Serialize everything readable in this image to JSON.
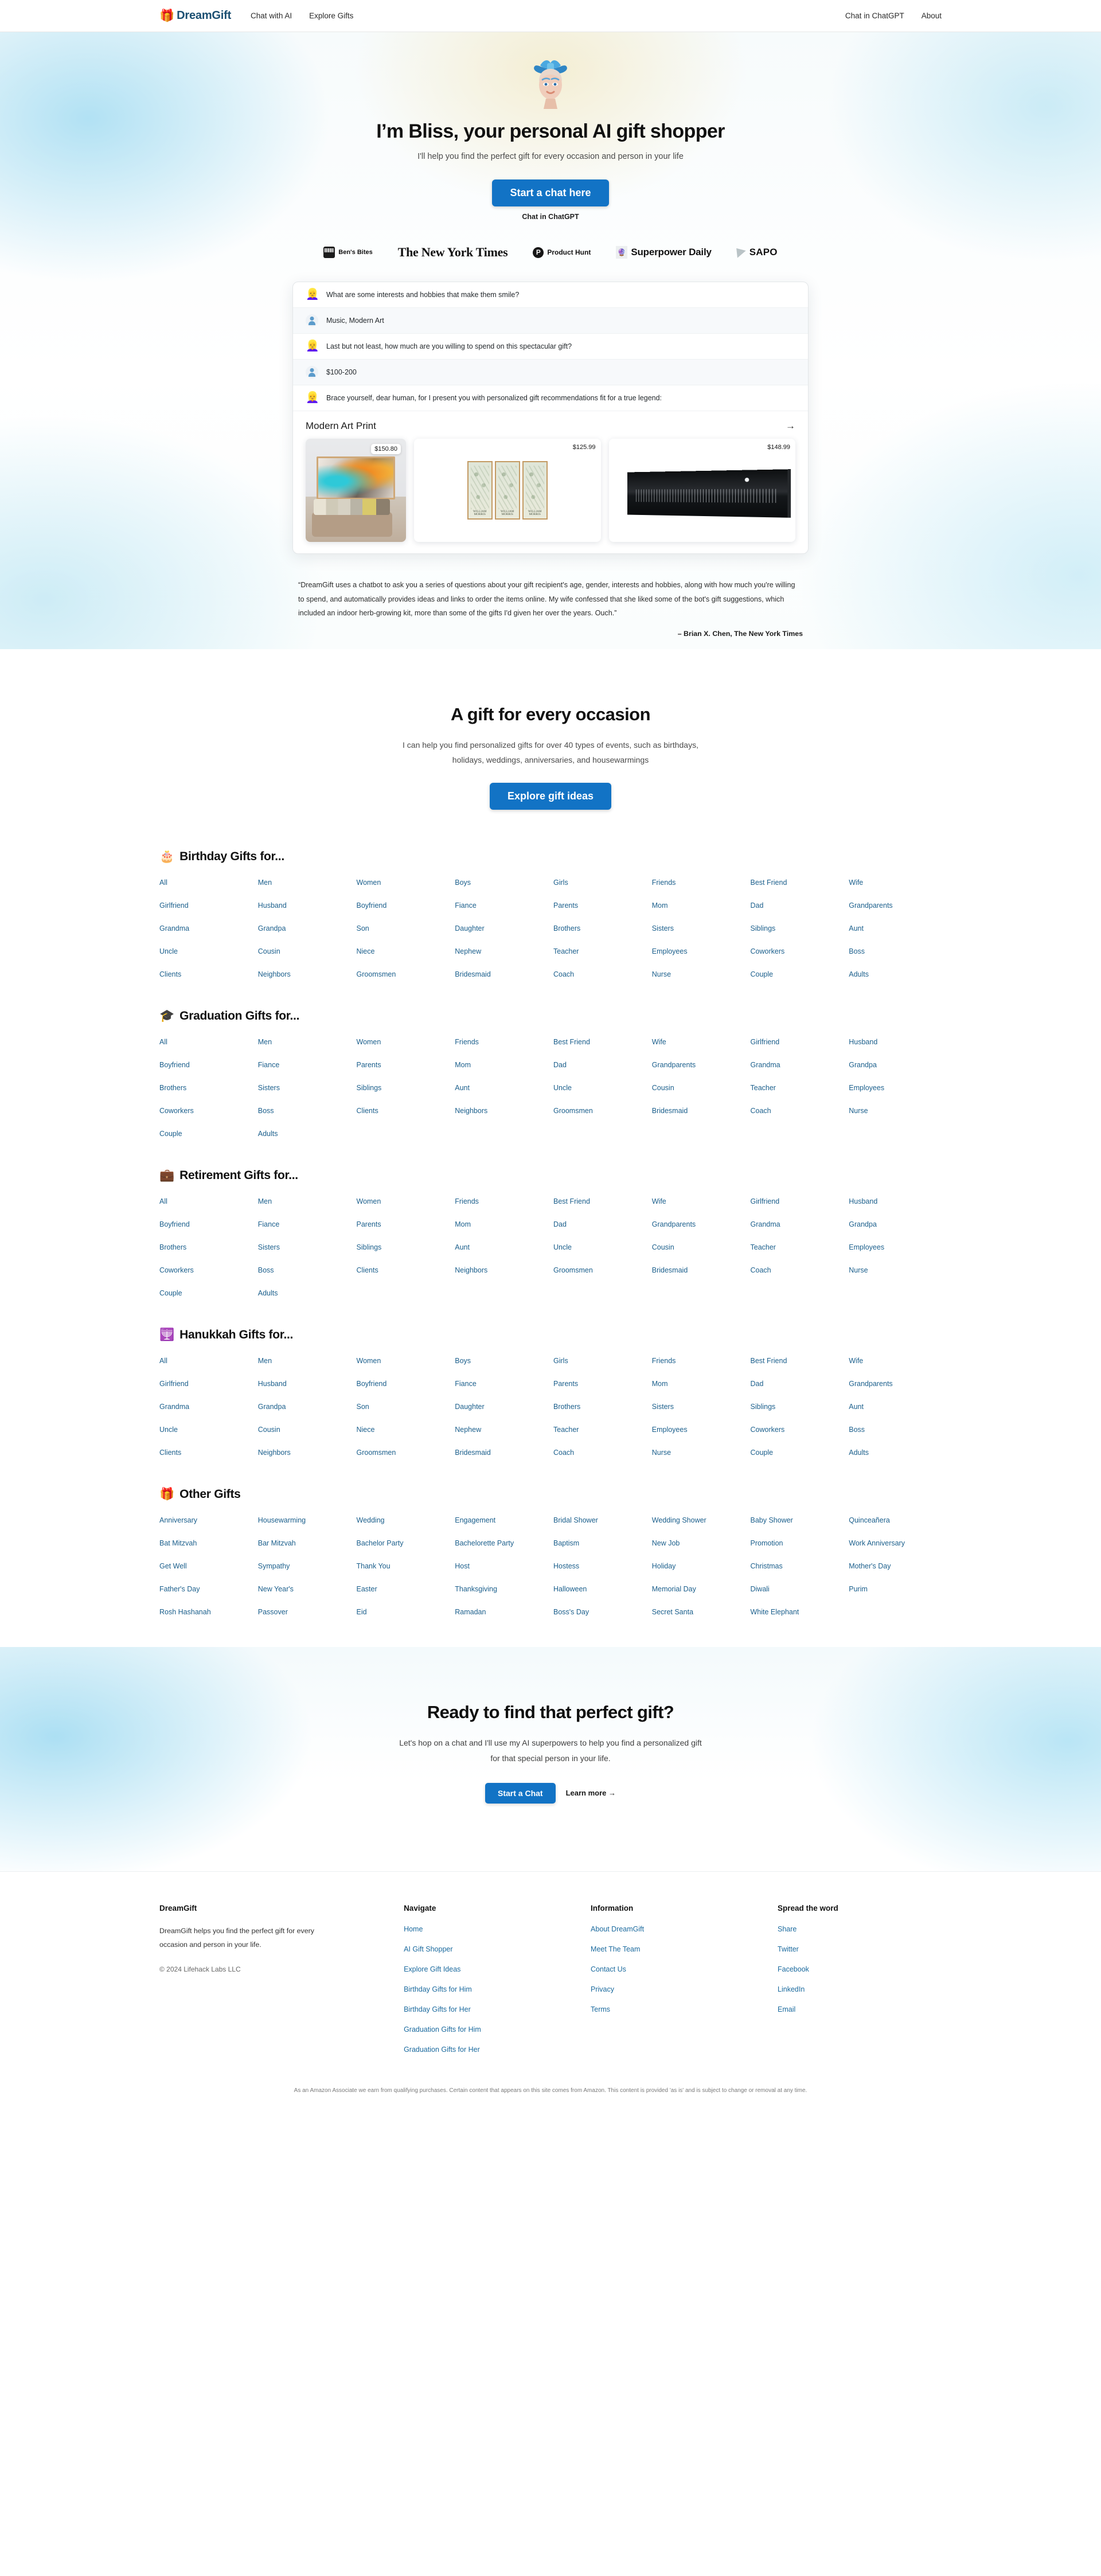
{
  "header": {
    "brand_emoji": "🎁",
    "brand_name": "DreamGift",
    "nav_left": [
      {
        "label": "Chat with AI"
      },
      {
        "label": "Explore Gifts"
      }
    ],
    "nav_right": [
      {
        "label": "Chat in ChatGPT"
      },
      {
        "label": "About"
      }
    ]
  },
  "hero": {
    "avatar_icon": "bliss-avatar",
    "title": "I’m Bliss, your personal AI gift shopper",
    "subtitle": "I'll help you find the perfect gift for every occasion and person in your life",
    "cta_label": "Start a chat here",
    "secondary_label": "Chat in ChatGPT"
  },
  "press": [
    {
      "name": "Ben's Bites",
      "icon": "bens-bites-icon"
    },
    {
      "name": "The New York Times",
      "icon": "nyt-wordmark"
    },
    {
      "name": "Product Hunt",
      "icon": "product-hunt-icon"
    },
    {
      "name": "Superpower Daily",
      "icon": "superpower-daily-icon"
    },
    {
      "name": "SAPO",
      "icon": "sapo-icon"
    }
  ],
  "chat_demo": {
    "messages": [
      {
        "role": "bot",
        "text": "What are some interests and hobbies that make them smile?"
      },
      {
        "role": "user",
        "text": "Music, Modern Art"
      },
      {
        "role": "bot",
        "text": "Last but not least, how much are you willing to spend on this spectacular gift?"
      },
      {
        "role": "user",
        "text": "$100-200"
      },
      {
        "role": "bot",
        "text": "Brace yourself, dear human, for I present you with personalized gift recommendations fit for a true legend:"
      }
    ],
    "recommendation": {
      "title": "Modern Art Print",
      "arrow_icon": "arrow-right-icon",
      "products": [
        {
          "price": "$150.80",
          "image": "abstract-canvas-over-sofa"
        },
        {
          "price": "$125.99",
          "image": "william-morris-triptych"
        },
        {
          "price": "$148.99",
          "image": "brooklyn-bridge-black-and-white"
        }
      ]
    }
  },
  "testimonial": {
    "quote": "“DreamGift uses a chatbot to ask you a series of questions about your gift recipient's age, gender, interests and hobbies, along with how much you're willing to spend, and automatically provides ideas and links to order the items online. My wife confessed that she liked some of the bot's gift suggestions, which included an indoor herb-growing kit, more than some of the gifts I'd given her over the years. Ouch.”",
    "attribution": "– Brian X. Chen, The New York Times"
  },
  "occasions_intro": {
    "title": "A gift for every occasion",
    "subtitle": "I can help you find personalized gifts for over 40 types of events, such as birthdays, holidays, weddings, anniversaries, and housewarmings",
    "cta_label": "Explore gift ideas"
  },
  "categories": [
    {
      "emoji": "🎂",
      "title": "Birthday Gifts for...",
      "links": [
        "All",
        "Men",
        "Women",
        "Boys",
        "Girls",
        "Friends",
        "Best Friend",
        "Wife",
        "Girlfriend",
        "Husband",
        "Boyfriend",
        "Fiance",
        "Parents",
        "Mom",
        "Dad",
        "Grandparents",
        "Grandma",
        "Grandpa",
        "Son",
        "Daughter",
        "Brothers",
        "Sisters",
        "Siblings",
        "Aunt",
        "Uncle",
        "Cousin",
        "Niece",
        "Nephew",
        "Teacher",
        "Employees",
        "Coworkers",
        "Boss",
        "Clients",
        "Neighbors",
        "Groomsmen",
        "Bridesmaid",
        "Coach",
        "Nurse",
        "Couple",
        "Adults"
      ]
    },
    {
      "emoji": "🎓",
      "title": "Graduation Gifts for...",
      "links": [
        "All",
        "Men",
        "Women",
        "Friends",
        "Best Friend",
        "Wife",
        "Girlfriend",
        "Husband",
        "Boyfriend",
        "Fiance",
        "Parents",
        "Mom",
        "Dad",
        "Grandparents",
        "Grandma",
        "Grandpa",
        "Brothers",
        "Sisters",
        "Siblings",
        "Aunt",
        "Uncle",
        "Cousin",
        "Teacher",
        "Employees",
        "Coworkers",
        "Boss",
        "Clients",
        "Neighbors",
        "Groomsmen",
        "Bridesmaid",
        "Coach",
        "Nurse",
        "Couple",
        "Adults"
      ]
    },
    {
      "emoji": "💼",
      "title": "Retirement Gifts for...",
      "links": [
        "All",
        "Men",
        "Women",
        "Friends",
        "Best Friend",
        "Wife",
        "Girlfriend",
        "Husband",
        "Boyfriend",
        "Fiance",
        "Parents",
        "Mom",
        "Dad",
        "Grandparents",
        "Grandma",
        "Grandpa",
        "Brothers",
        "Sisters",
        "Siblings",
        "Aunt",
        "Uncle",
        "Cousin",
        "Teacher",
        "Employees",
        "Coworkers",
        "Boss",
        "Clients",
        "Neighbors",
        "Groomsmen",
        "Bridesmaid",
        "Coach",
        "Nurse",
        "Couple",
        "Adults"
      ]
    },
    {
      "emoji": "🕎",
      "title": "Hanukkah Gifts for...",
      "links": [
        "All",
        "Men",
        "Women",
        "Boys",
        "Girls",
        "Friends",
        "Best Friend",
        "Wife",
        "Girlfriend",
        "Husband",
        "Boyfriend",
        "Fiance",
        "Parents",
        "Mom",
        "Dad",
        "Grandparents",
        "Grandma",
        "Grandpa",
        "Son",
        "Daughter",
        "Brothers",
        "Sisters",
        "Siblings",
        "Aunt",
        "Uncle",
        "Cousin",
        "Niece",
        "Nephew",
        "Teacher",
        "Employees",
        "Coworkers",
        "Boss",
        "Clients",
        "Neighbors",
        "Groomsmen",
        "Bridesmaid",
        "Coach",
        "Nurse",
        "Couple",
        "Adults"
      ]
    },
    {
      "emoji": "🎁",
      "title": "Other Gifts",
      "links": [
        "Anniversary",
        "Housewarming",
        "Wedding",
        "Engagement",
        "Bridal Shower",
        "Wedding Shower",
        "Baby Shower",
        "Quinceañera",
        "Bat Mitzvah",
        "Bar Mitzvah",
        "Bachelor Party",
        "Bachelorette Party",
        "Baptism",
        "New Job",
        "Promotion",
        "Work Anniversary",
        "Get Well",
        "Sympathy",
        "Thank You",
        "Host",
        "Hostess",
        "Holiday",
        "Christmas",
        "Mother's Day",
        "Father's Day",
        "New Year's",
        "Easter",
        "Thanksgiving",
        "Halloween",
        "Memorial Day",
        "Diwali",
        "Purim",
        "Rosh Hashanah",
        "Passover",
        "Eid",
        "Ramadan",
        "Boss's Day",
        "Secret Santa",
        "White Elephant"
      ]
    }
  ],
  "final_cta": {
    "title": "Ready to find that perfect gift?",
    "subtitle": "Let's hop on a chat and I'll use my AI superpowers to help you find a personalized gift for that special person in your life.",
    "primary_label": "Start a Chat",
    "secondary_label": "Learn more →"
  },
  "footer": {
    "brand": {
      "title": "DreamGift",
      "description": "DreamGift helps you find the perfect gift for every occasion and person in your life.",
      "copyright": "© 2024 Lifehack Labs LLC"
    },
    "columns": [
      {
        "title": "Navigate",
        "links": [
          "Home",
          "AI Gift Shopper",
          "Explore Gift Ideas",
          "Birthday Gifts for Him",
          "Birthday Gifts for Her",
          "Graduation Gifts for Him",
          "Graduation Gifts for Her"
        ]
      },
      {
        "title": "Information",
        "links": [
          "About DreamGift",
          "Meet The Team",
          "Contact Us",
          "Privacy",
          "Terms"
        ]
      },
      {
        "title": "Spread the word",
        "links": [
          "Share",
          "Twitter",
          "Facebook",
          "LinkedIn",
          "Email"
        ]
      }
    ],
    "amazon_note": "As an Amazon Associate we earn from qualifying purchases. Certain content that appears on this site comes from Amazon. This content is provided 'as is' and is subject to change or removal at any time."
  },
  "colors": {
    "accent": "#1273c5",
    "link": "#1b5f8c",
    "brand": "#1b4f72"
  }
}
